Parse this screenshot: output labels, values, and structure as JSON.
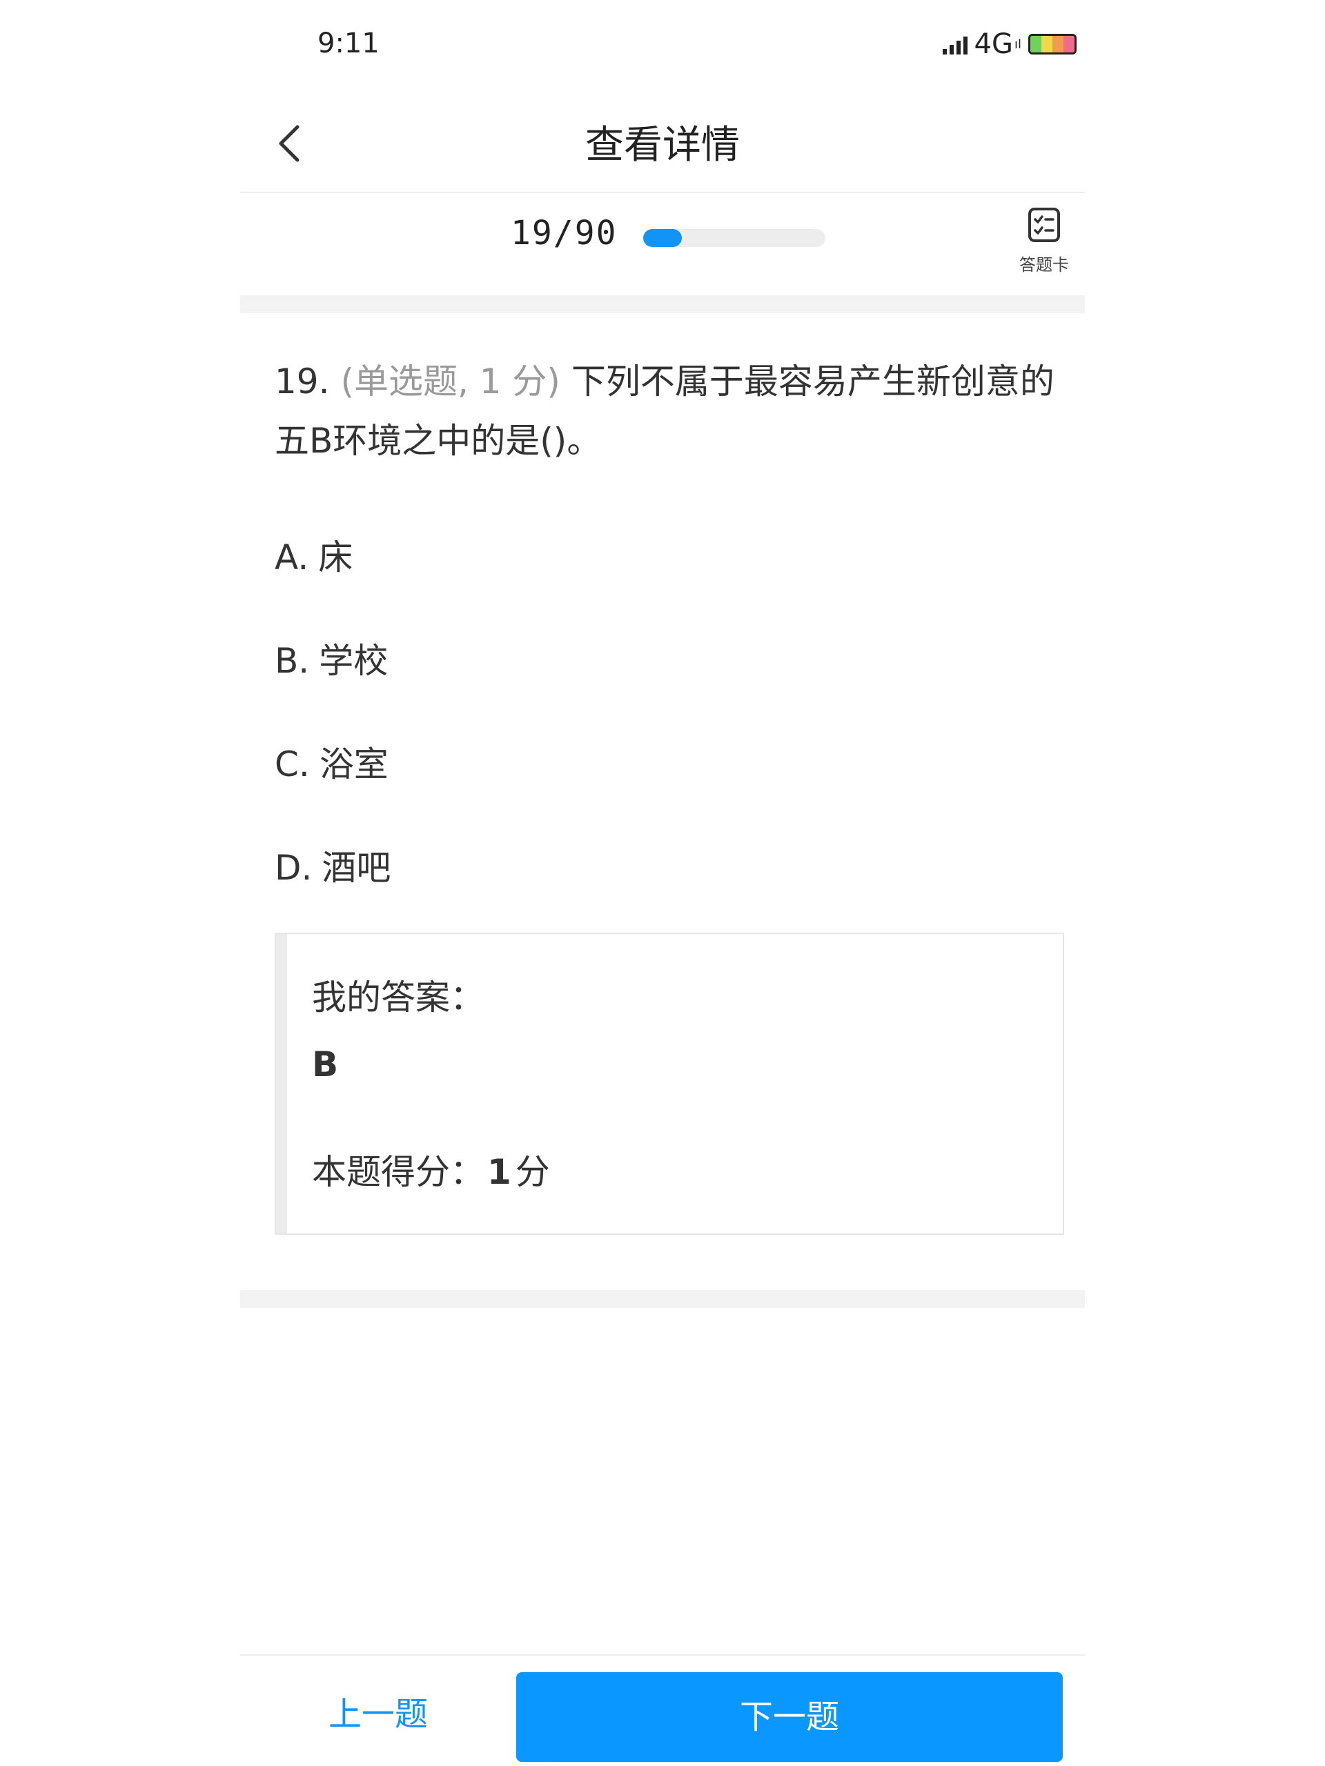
{
  "status_bar": {
    "time": "9:11",
    "network": "4G",
    "network_suffix": "ıl"
  },
  "header": {
    "title": "查看详情",
    "back_icon": "chevron-left-icon"
  },
  "progress": {
    "text": "19/90",
    "current": 19,
    "total": 90,
    "accent_color": "#1294f6",
    "card_label": "答题卡",
    "card_icon": "checklist-icon"
  },
  "question": {
    "number": "19.",
    "meta": "(单选题, 1 分)",
    "text": "下列不属于最容易产生新创意的五B环境之中的是()。",
    "options": [
      {
        "letter": "A.",
        "text": "床"
      },
      {
        "letter": "B.",
        "text": "学校"
      },
      {
        "letter": "C.",
        "text": "浴室"
      },
      {
        "letter": "D.",
        "text": "酒吧"
      }
    ]
  },
  "answer": {
    "label": "我的答案：",
    "value": "B",
    "score_label": "本题得分：",
    "score_value": "1",
    "score_unit": "分"
  },
  "footer": {
    "prev_label": "上一题",
    "next_label": "下一题",
    "button_color": "#0a97ff"
  }
}
